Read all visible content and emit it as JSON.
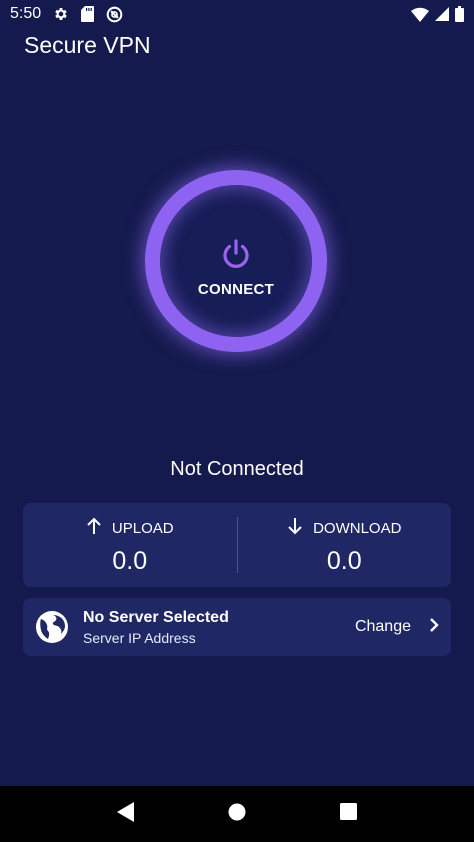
{
  "status_bar": {
    "time": "5:50",
    "icons_left": [
      "gear-icon",
      "sd-card-icon",
      "vpn-key-icon"
    ],
    "icons_right": [
      "wifi-icon",
      "signal-icon",
      "battery-icon"
    ]
  },
  "app": {
    "title": "Secure VPN"
  },
  "connect_button": {
    "label": "CONNECT",
    "icon": "power-icon",
    "ring_color": "#8f63f2"
  },
  "connection": {
    "status": "Not Connected"
  },
  "stats": {
    "upload_label": "UPLOAD",
    "upload_value": "0.0",
    "download_label": "DOWNLOAD",
    "download_value": "0.0"
  },
  "server": {
    "name": "No Server Selected",
    "ip_label": "Server IP Address",
    "change_label": "Change"
  },
  "nav": {
    "buttons": [
      "back-icon",
      "home-icon",
      "recents-icon"
    ]
  },
  "colors": {
    "background": "#141a4d",
    "card": "#1f2865",
    "accent": "#8f63f2"
  }
}
